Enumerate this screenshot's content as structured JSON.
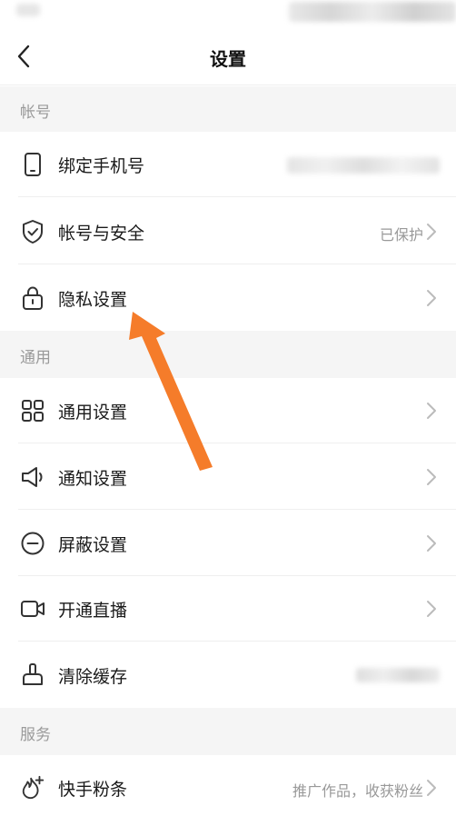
{
  "header": {
    "title": "设置"
  },
  "sections": [
    {
      "title": "帐号",
      "items": [
        {
          "label": "绑定手机号",
          "icon": "phone-icon"
        },
        {
          "label": "帐号与安全",
          "value": "已保护",
          "icon": "shield-icon"
        },
        {
          "label": "隐私设置",
          "icon": "lock-icon"
        }
      ]
    },
    {
      "title": "通用",
      "items": [
        {
          "label": "通用设置",
          "icon": "grid-icon"
        },
        {
          "label": "通知设置",
          "icon": "speaker-icon"
        },
        {
          "label": "屏蔽设置",
          "icon": "block-icon"
        },
        {
          "label": "开通直播",
          "icon": "camera-icon"
        },
        {
          "label": "清除缓存",
          "icon": "broom-icon"
        }
      ]
    },
    {
      "title": "服务",
      "items": [
        {
          "label": "快手粉条",
          "value": "推广作品，收获粉丝",
          "icon": "flame-plus-icon"
        }
      ]
    }
  ],
  "colors": {
    "accent_arrow": "#f57c2a",
    "section_bg": "#f5f5f5",
    "secondary_text": "#999999"
  }
}
